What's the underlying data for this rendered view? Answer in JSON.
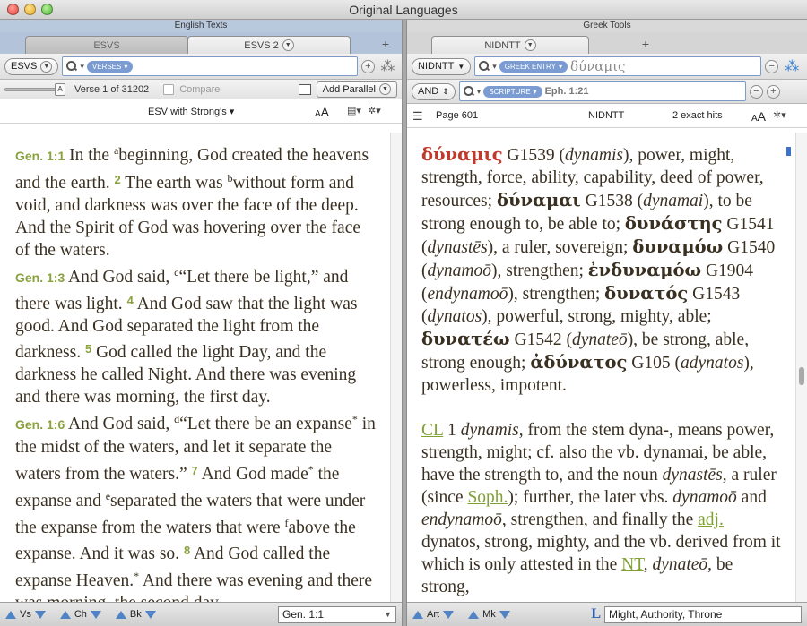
{
  "window": {
    "title": "Original Languages"
  },
  "left": {
    "pane_title": "English Texts",
    "tabs": [
      {
        "label": "ESVS",
        "active": false
      },
      {
        "label": "ESVS 2",
        "active": true
      }
    ],
    "tab_add": "+",
    "toolbar": {
      "module": "ESVS",
      "search_pill": "VERSES",
      "search_value": ""
    },
    "subtoolbar": {
      "slider_letter": "A",
      "verse_status": "Verse 1 of 31202",
      "compare_label": "Compare",
      "add_parallel": "Add Parallel"
    },
    "resource": {
      "name": "ESV with Strong's",
      "font_small": "A",
      "font_large": "A"
    },
    "text": {
      "p1_ref": "Gen. 1:1",
      "p1_a": " In the ",
      "p1_fn_a": "a",
      "p1_b": "beginning, God created the heavens and the earth. ",
      "p1_v2": "2",
      "p1_c": " The earth was ",
      "p1_fn_b": "b",
      "p1_d": "without form and void, and darkness was over the face of the deep. And the Spirit of God was hovering over the face of the waters.",
      "p2_ref": "Gen. 1:3",
      "p2_a": " And God said, ",
      "p2_fn_c": "c",
      "p2_b": "“Let there be light,” and there was light. ",
      "p2_v4": "4",
      "p2_c": " And God saw that the light was good. And God separated the light from the darkness. ",
      "p2_v5": "5",
      "p2_d": " God called the light Day, and the darkness he called Night. And there was evening and there was morning, the first day.",
      "p3_ref": "Gen. 1:6",
      "p3_a": " And God said, ",
      "p3_fn_d": "d",
      "p3_b": "“Let there be an expanse",
      "p3_star1": "*",
      "p3_c": " in the midst of the waters, and let it separate the waters from the waters.” ",
      "p3_v7": "7",
      "p3_d": " And God made",
      "p3_star2": "*",
      "p3_e": " the expanse and ",
      "p3_fn_e": "e",
      "p3_f": "separated the waters that were under the expanse from the waters that were ",
      "p3_fn_f": "f",
      "p3_g": "above the expanse. And it was so. ",
      "p3_v8": "8",
      "p3_h": " And God called the expanse Heaven.",
      "p3_star3": "*",
      "p3_i": " And there was evening and there was morning, the second day."
    },
    "bottom": {
      "nav": [
        "Vs",
        "Ch",
        "Bk"
      ],
      "reference": "Gen. 1:1"
    }
  },
  "right": {
    "pane_title": "Greek Tools",
    "tabs": [
      {
        "label": "NIDNTT",
        "active": true
      }
    ],
    "tab_add": "+",
    "toolbar": {
      "module": "NIDNTT",
      "search_pill": "GREEK ENTRY",
      "search_value": "δύναμις"
    },
    "toolbar2": {
      "operator": "AND",
      "scripture_pill": "SCRIPTURE",
      "scripture_value": "Eph. 1:21"
    },
    "resource": {
      "page": "Page 601",
      "name": "NIDNTT",
      "hits": "2 exact hits",
      "font_small": "A",
      "font_large": "A"
    },
    "entry": {
      "w1": "δύναμις",
      "t1": " G1539 (",
      "tr1": "dynamis",
      "t1b": "), power, might, strength, force, ability, capability, deed of power, resources; ",
      "w2": "δύναμαι",
      "t2": " G1538 (",
      "tr2": "dynamai",
      "t2b": "), to be strong enough to, be able to; ",
      "w3": "δυνάστης",
      "t3": " G1541 (",
      "tr3": "dynastēs",
      "t3b": "), a ruler, sovereign; ",
      "w4": "δυναμόω",
      "t4": " G1540 (",
      "tr4": "dynamoō",
      "t4b": "), strengthen; ",
      "w5": "ἐνδυναμόω",
      "t5": " G1904 (",
      "tr5": "endynamoō",
      "t5b": "), strengthen; ",
      "w6": "δυνατός",
      "t6": " G1543 (",
      "tr6": "dynatos",
      "t6b": "), powerful, strong, mighty, able; ",
      "w7": "δυνατέω",
      "t7": " G1542 (",
      "tr7": "dynateō",
      "t7b": "), be strong, able, strong enough; ",
      "w8": "ἀδύνατος",
      "t8": " G105 (",
      "tr8": "adynatos",
      "t8b": "), powerless, impotent."
    },
    "section": {
      "cl": "CL",
      "a": " 1 ",
      "a_i": "dynamis",
      "b": ", from the stem dyna-, means power, strength, might; cf. also the vb. dynamai, be able, have the strength to, and the noun ",
      "b_i": "dynastēs",
      "c": ", a ruler (since ",
      "soph": "Soph.",
      "d": "); further, the later vbs. ",
      "d_i1": "dynamoō",
      "e": " and ",
      "d_i2": "endynamoō",
      "f": ", strengthen, and finally the ",
      "adj": "adj.",
      "g": " dynatos, strong, mighty, and the vb. derived from it which is only attested in the ",
      "nt": "NT",
      "h": ", ",
      "h_i": "dynateō",
      "i": ", be strong,"
    },
    "bottom": {
      "nav": [
        "Art",
        "Mk"
      ],
      "topic": "Might, Authority, Throne"
    }
  }
}
